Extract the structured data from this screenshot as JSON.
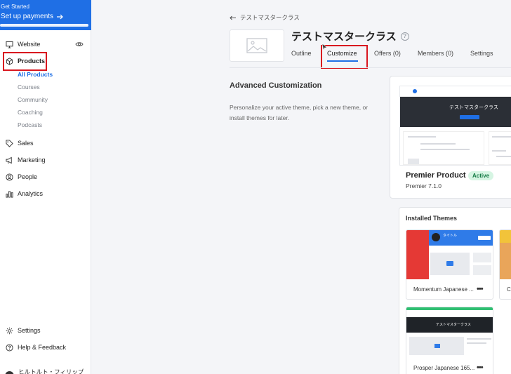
{
  "banner": {
    "line1": "Get Started",
    "line2": "Set up payments"
  },
  "sidebar": {
    "website": "Website",
    "products": "Products",
    "sub_items": [
      "All Products",
      "Courses",
      "Community",
      "Coaching",
      "Podcasts"
    ],
    "sales": "Sales",
    "marketing": "Marketing",
    "people": "People",
    "analytics": "Analytics",
    "settings": "Settings",
    "help": "Help & Feedback",
    "user_name": "ヒルトルト・フィリップ太…"
  },
  "header": {
    "back": "テストマスタークラス",
    "title": "テストマスタークラス",
    "tabs": [
      "Outline",
      "Customize",
      "Offers (0)",
      "Members (0)",
      "Settings"
    ]
  },
  "section": {
    "title": "Advanced Customization",
    "description": "Personalize your active theme, pick a new theme, or install themes for later."
  },
  "active_theme": {
    "preview_title": "テストマスタークラス",
    "name": "Premier Product",
    "badge": "Active",
    "version": "Premier 7.1.0"
  },
  "installed": {
    "title": "Installed Themes",
    "themes": [
      {
        "name": "Momentum Japanese ...",
        "preview_title": "タイトル"
      },
      {
        "name": "Co"
      },
      {
        "name": "Prosper Japanese 165...",
        "preview_title": "テストマスタークラス"
      }
    ]
  },
  "colors": {
    "accent": "#1f6fe5",
    "highlight": "#d9161f",
    "active_badge_bg": "#d6f5e3"
  }
}
